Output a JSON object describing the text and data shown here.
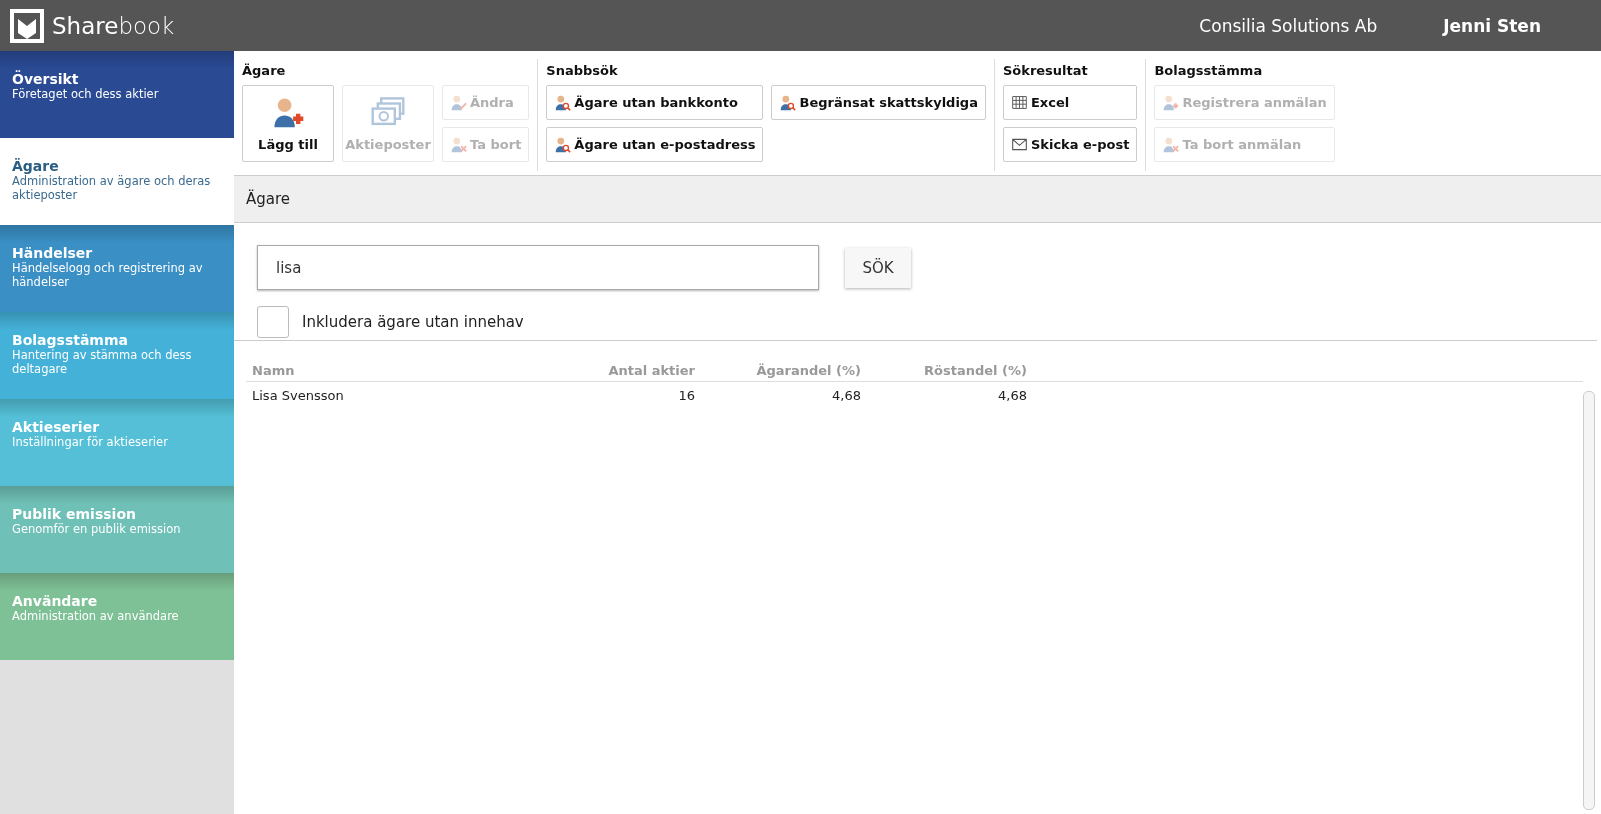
{
  "header": {
    "logo": "**Share**book",
    "company": "Consilia Solutions Ab",
    "user": "Jenni Sten"
  },
  "sidebar": {
    "items": [
      {
        "title": "Översikt",
        "subtitle": "Företaget och dess aktier",
        "selected": false,
        "color": "#2a4a94"
      },
      {
        "title": "Ägare",
        "subtitle": "Administration av ägare och deras aktieposter",
        "selected": true
      },
      {
        "title": "Händelser",
        "subtitle": "Händelselogg och registrering av händelser",
        "selected": false,
        "color": "#3a8fc4"
      },
      {
        "title": "Bolagsstämma",
        "subtitle": "Hantering av stämma och dess deltagare",
        "selected": false,
        "color": "#44b1d8"
      },
      {
        "title": "Aktieserier",
        "subtitle": "Inställningar för aktieserier",
        "selected": false,
        "color": "#54bfd6"
      },
      {
        "title": "Publik emission",
        "subtitle": "Genomför en publik emission",
        "selected": false,
        "color": "#6fc0b6"
      },
      {
        "title": "Användare",
        "subtitle": "Administration av användare",
        "selected": false,
        "color": "#7fc196"
      }
    ]
  },
  "toolbar": {
    "groups": [
      {
        "title": "Ägare",
        "buttons": [
          {
            "label": "Lägg till",
            "kind": "add-user",
            "disabled": false
          },
          {
            "label": "Aktieposter",
            "kind": "shares",
            "disabled": true
          },
          {
            "label": "Ändra",
            "kind": "edit-user",
            "disabled": true
          },
          {
            "label": "Ta bort",
            "kind": "remove-user",
            "disabled": true
          }
        ]
      },
      {
        "title": "Snabbsök",
        "buttons": [
          {
            "label": "Ägare utan bankkonto",
            "kind": "search-user",
            "disabled": false
          },
          {
            "label": "Ägare utan e-postadress",
            "kind": "search-user",
            "disabled": false
          },
          {
            "label": "Begränsat skattskyldiga",
            "kind": "search-user",
            "disabled": false
          }
        ]
      },
      {
        "title": "Sökresultat",
        "buttons": [
          {
            "label": "Excel",
            "kind": "table",
            "disabled": false
          },
          {
            "label": "Skicka e-post",
            "kind": "mail",
            "disabled": false
          }
        ]
      },
      {
        "title": "Bolagsstämma",
        "buttons": [
          {
            "label": "Registrera anmälan",
            "kind": "add-user",
            "disabled": true
          },
          {
            "label": "Ta bort anmälan",
            "kind": "remove-user",
            "disabled": true
          }
        ]
      }
    ]
  },
  "section": {
    "title": "Ägare"
  },
  "search": {
    "value": "lisa",
    "button": "SÖK",
    "checkbox": {
      "label": "Inkludera ägare utan innehav",
      "checked": false
    }
  },
  "table": {
    "columns": [
      "Namn",
      "Antal aktier",
      "Ägarandel (%)",
      "Röstandel (%)"
    ],
    "rows": [
      [
        "Lisa Svensson",
        "16",
        "4,68",
        "4,68"
      ]
    ]
  }
}
